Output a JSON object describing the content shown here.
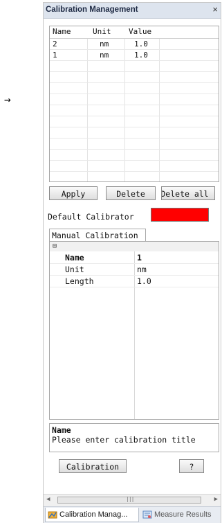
{
  "annotation": {
    "arrow": "→"
  },
  "panel": {
    "title": "Calibration Management",
    "close_glyph": "×"
  },
  "list": {
    "columns": [
      "Name",
      "Unit",
      "Value"
    ],
    "rows": [
      {
        "name": "2",
        "unit": "nm",
        "value": "1.0"
      },
      {
        "name": "1",
        "unit": "nm",
        "value": "1.0"
      }
    ]
  },
  "buttons": {
    "apply": "Apply",
    "delete": "Delete",
    "delete_all": "Delete all"
  },
  "default_calibrator": {
    "label": "Default Calibrator",
    "color": "#ff0000"
  },
  "tab": {
    "label": "Manual Calibration"
  },
  "property_grid": {
    "collapse_glyph": "⊟",
    "rows": [
      {
        "name": "Name",
        "value": "1"
      },
      {
        "name": "Unit",
        "value": "nm"
      },
      {
        "name": "Length",
        "value": "1.0"
      }
    ]
  },
  "description": {
    "title": "Name",
    "text": "Please enter calibration title"
  },
  "actions": {
    "calibration": "Calibration",
    "help": "?"
  },
  "scrollbar": {
    "left": "◀",
    "right": "▶",
    "grip": "|||"
  },
  "bottom_tabs": [
    {
      "label": "Calibration Manag...",
      "icon": "calibration-icon"
    },
    {
      "label": "Measure Results",
      "icon": "measure-results-icon"
    }
  ]
}
